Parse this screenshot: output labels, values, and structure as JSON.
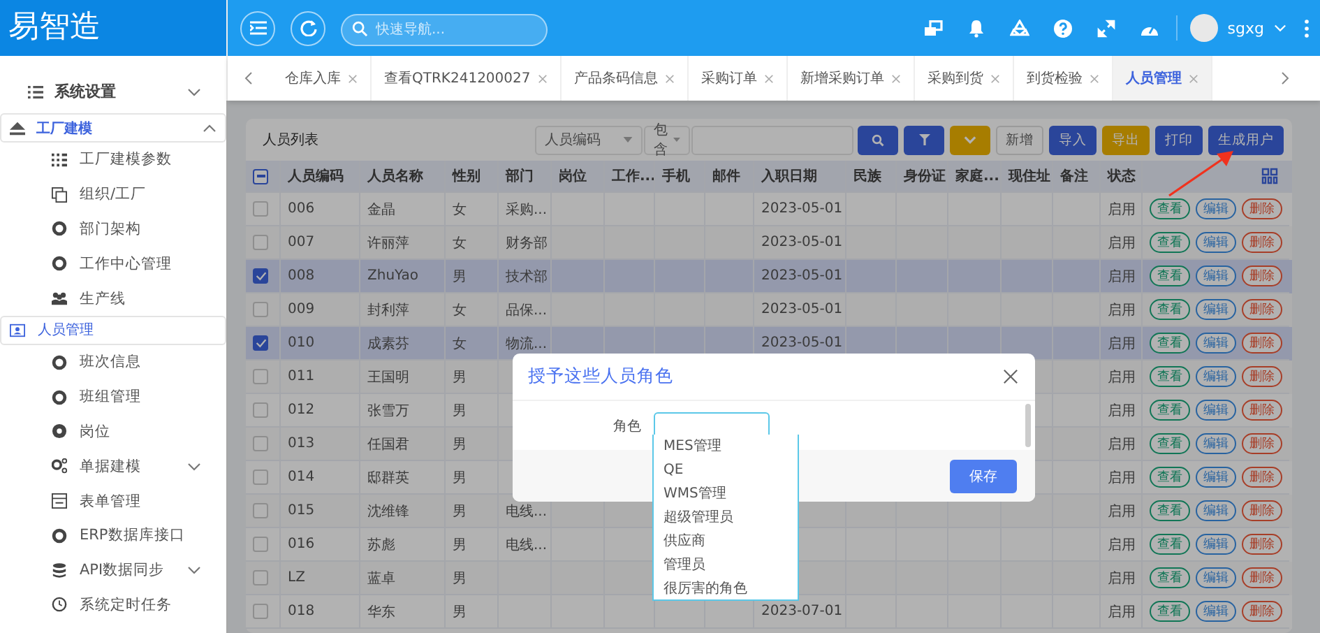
{
  "sidebar": {
    "logo": "易智造",
    "items": [
      {
        "label": "系统设置",
        "expanded": false,
        "selected": false
      },
      {
        "label": "工厂建模",
        "expanded": true,
        "selected": true,
        "children": [
          {
            "label": "工厂建模参数",
            "selected": false
          },
          {
            "label": "组织/工厂",
            "selected": false
          },
          {
            "label": "部门架构",
            "selected": false
          },
          {
            "label": "工作中心管理",
            "selected": false
          },
          {
            "label": "生产线",
            "selected": false
          },
          {
            "label": "人员管理",
            "selected": true
          },
          {
            "label": "班次信息",
            "selected": false
          },
          {
            "label": "班组管理",
            "selected": false
          },
          {
            "label": "岗位",
            "selected": false
          },
          {
            "label": "单据建模",
            "selected": false,
            "expanded": false
          },
          {
            "label": "表单管理",
            "selected": false
          },
          {
            "label": "ERP数据库接口",
            "selected": false
          },
          {
            "label": "API数据同步",
            "selected": false,
            "expanded": false
          },
          {
            "label": "系统定时任务",
            "selected": false
          }
        ]
      }
    ]
  },
  "header": {
    "search": {
      "placeholder": "快速导航..."
    },
    "user": {
      "name": "sgxg"
    }
  },
  "tabs": [
    {
      "label": "仓库入库",
      "selected": false
    },
    {
      "label": "查看QTRK241200027",
      "selected": false
    },
    {
      "label": "产品条码信息",
      "selected": false
    },
    {
      "label": "采购订单",
      "selected": false
    },
    {
      "label": "新增采购订单",
      "selected": false
    },
    {
      "label": "采购到货",
      "selected": false
    },
    {
      "label": "到货检验",
      "selected": false
    },
    {
      "label": "人员管理",
      "selected": true
    }
  ],
  "toolbar": {
    "title": "人员列表",
    "filter_field": "人员编码",
    "filter_op": "包含",
    "buttons": [
      {
        "kind": "search"
      },
      {
        "kind": "filter"
      },
      {
        "kind": "collapse"
      },
      {
        "kind": "plain",
        "label": "新增"
      },
      {
        "kind": "primary",
        "label": "导入"
      },
      {
        "kind": "warning",
        "label": "导出"
      },
      {
        "kind": "primary",
        "label": "打印"
      },
      {
        "kind": "primary",
        "label": "生成用户"
      }
    ]
  },
  "table": {
    "select_all_indeterminate": true,
    "columns": [
      "人员编码",
      "人员名称",
      "性别",
      "部门",
      "岗位",
      "工作...",
      "手机",
      "邮件",
      "入职日期",
      "民族",
      "身份证",
      "家庭...",
      "现住址",
      "备注",
      "状态"
    ],
    "rows": [
      {
        "code": "006",
        "name": "金晶",
        "gender": "女",
        "dept": "采购...",
        "date": "2023-05-01",
        "status": "启用",
        "selected": false,
        "actions": [
          "查看",
          "编辑",
          "删除"
        ]
      },
      {
        "code": "007",
        "name": "许丽萍",
        "gender": "女",
        "dept": "财务部",
        "date": "2023-05-01",
        "status": "启用",
        "selected": false,
        "actions": [
          "查看",
          "编辑",
          "删除"
        ]
      },
      {
        "code": "008",
        "name": "ZhuYao",
        "gender": "男",
        "dept": "技术部",
        "date": "2023-05-01",
        "status": "启用",
        "selected": true,
        "actions": [
          "查看",
          "编辑",
          "删除"
        ]
      },
      {
        "code": "009",
        "name": "封利萍",
        "gender": "女",
        "dept": "品保...",
        "date": "2023-05-01",
        "status": "启用",
        "selected": false,
        "actions": [
          "查看",
          "编辑",
          "删除"
        ]
      },
      {
        "code": "010",
        "name": "成素芬",
        "gender": "女",
        "dept": "物流...",
        "date": "2023-05-01",
        "status": "启用",
        "selected": true,
        "actions": [
          "查看",
          "编辑",
          "删除"
        ]
      },
      {
        "code": "011",
        "name": "王国明",
        "gender": "男",
        "status": "启用",
        "selected": false,
        "actions": [
          "查看",
          "编辑",
          "删除"
        ]
      },
      {
        "code": "012",
        "name": "张雪万",
        "gender": "男",
        "status": "启用",
        "selected": false,
        "actions": [
          "查看",
          "编辑",
          "删除"
        ]
      },
      {
        "code": "013",
        "name": "任国君",
        "gender": "男",
        "status": "启用",
        "selected": false,
        "actions": [
          "查看",
          "编辑",
          "删除"
        ]
      },
      {
        "code": "014",
        "name": "邸群英",
        "gender": "男",
        "status": "启用",
        "selected": false,
        "actions": [
          "查看",
          "编辑",
          "删除"
        ]
      },
      {
        "code": "015",
        "name": "沈维锋",
        "gender": "男",
        "dept": "电线...",
        "status": "启用",
        "selected": false,
        "actions": [
          "查看",
          "编辑",
          "删除"
        ]
      },
      {
        "code": "016",
        "name": "苏彪",
        "gender": "男",
        "dept": "电线...",
        "status": "启用",
        "selected": false,
        "actions": [
          "查看",
          "编辑",
          "删除"
        ]
      },
      {
        "code": "LZ",
        "name": "蓝卓",
        "gender": "男",
        "status": "启用",
        "selected": false,
        "actions": [
          "查看",
          "编辑",
          "删除"
        ]
      },
      {
        "code": "018",
        "name": "华东",
        "gender": "男",
        "date": "2023-07-01",
        "status": "启用",
        "selected": false,
        "actions": [
          "查看",
          "编辑",
          "删除"
        ]
      }
    ]
  },
  "dialog": {
    "title": "授予这些人员角色",
    "field_label": "角色",
    "options": [
      "MES管理",
      "QE",
      "WMS管理",
      "超级管理员",
      "供应商",
      "管理员",
      "很厉害的角色"
    ],
    "save": "保存"
  }
}
